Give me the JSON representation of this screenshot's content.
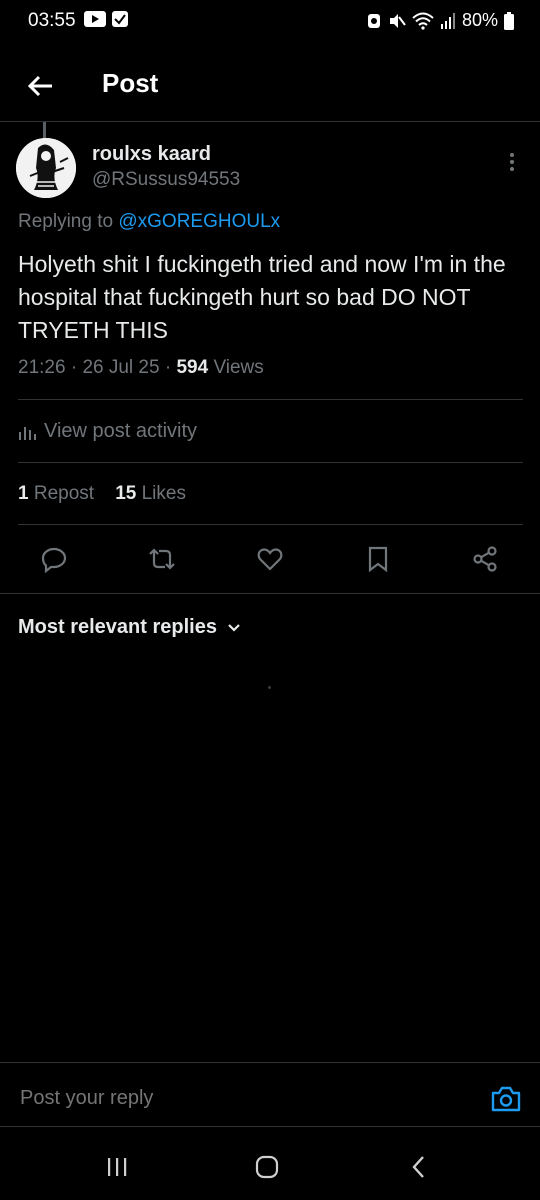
{
  "status_bar": {
    "time": "03:55",
    "battery": "80%",
    "left_icons": [
      "youtube-icon",
      "check-box-icon"
    ],
    "right_icons": [
      "alarm-icon",
      "mute-icon",
      "wifi-icon",
      "signal-icon",
      "battery-icon"
    ]
  },
  "header": {
    "title": "Post",
    "back_icon": "arrow-left-icon"
  },
  "post": {
    "display_name": "roulxs kaard",
    "handle": "@RSussus94553",
    "replying_prefix": "Replying to",
    "replying_handle": "@xGOREGHOULx",
    "text": "Holyeth shit I fuckingeth tried and now I'm in the hospital that fuckingeth hurt so bad DO NOT TRYETH THIS",
    "time": "21:26",
    "date": "26 Jul 25",
    "views_count": "594",
    "views_label": "Views",
    "activity_label": "View post activity",
    "repost_count": "1",
    "repost_label": "Repost",
    "likes_count": "15",
    "likes_label": "Likes"
  },
  "actions": {
    "icons": [
      "reply-icon",
      "repost-icon",
      "like-icon",
      "bookmark-icon",
      "share-icon"
    ]
  },
  "replies": {
    "sort_label": "Most relevant replies"
  },
  "composer": {
    "placeholder": "Post your reply"
  },
  "colors": {
    "background": "#000000",
    "accent": "#1d9bf0",
    "secondary_text": "#71767b",
    "primary_text": "#e7e9ea",
    "divider": "#2f3336"
  }
}
